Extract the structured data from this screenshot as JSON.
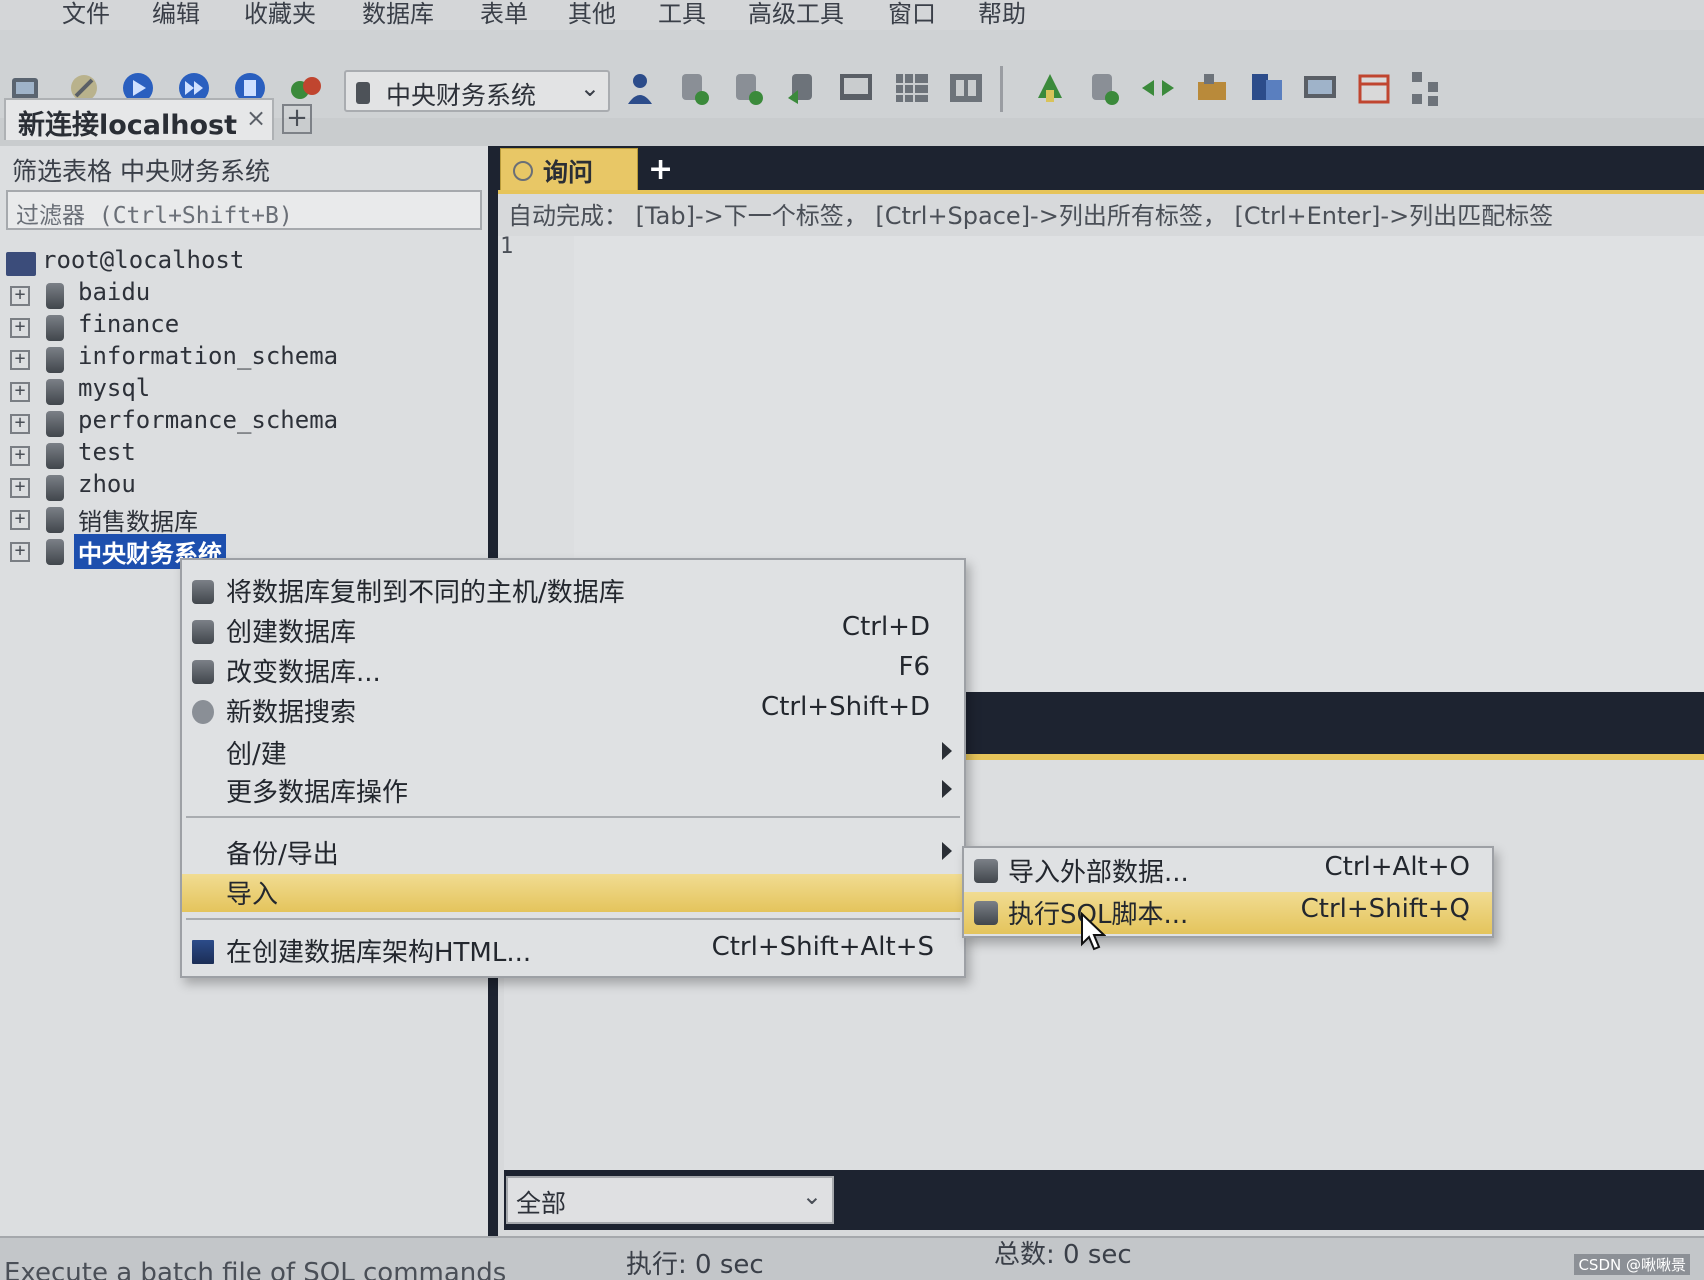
{
  "menubar": {
    "items": [
      "文件",
      "编辑",
      "收藏夹",
      "数据库",
      "表单",
      "其他",
      "工具",
      "高级工具",
      "窗口",
      "帮助"
    ]
  },
  "toolbar": {
    "database_select": "中央财务系统"
  },
  "connection_tab": {
    "label": "新连接localhost",
    "close": "×",
    "add": "+"
  },
  "left_pane": {
    "filter_title": "筛选表格  中央财务系统",
    "filter_placeholder": "过滤器 (Ctrl+Shift+B)",
    "root": "root@localhost",
    "databases": [
      "baidu",
      "finance",
      "information_schema",
      "mysql",
      "performance_schema",
      "test",
      "zhou",
      "销售数据库",
      "中央财务系统"
    ],
    "selected": "中央财务系统"
  },
  "query": {
    "tab_label": "询问",
    "add": "+",
    "hint": "自动完成：  [Tab]->下一个标签，  [Ctrl+Space]->列出所有标签，  [Ctrl+Enter]->列出匹配标签",
    "line_number": "1"
  },
  "result": {
    "filter_value": "全部"
  },
  "context_menu": {
    "items": [
      {
        "label": "将数据库复制到不同的主机/数据库",
        "shortcut": ""
      },
      {
        "label": "创建数据库",
        "shortcut": "Ctrl+D"
      },
      {
        "label": "改变数据库...",
        "shortcut": "F6"
      },
      {
        "label": "新数据搜索",
        "shortcut": "Ctrl+Shift+D"
      },
      {
        "label": "创/建",
        "shortcut": ""
      },
      {
        "label": "更多数据库操作",
        "shortcut": ""
      },
      {
        "label": "备份/导出",
        "shortcut": ""
      },
      {
        "label": "导入",
        "shortcut": ""
      },
      {
        "label": "在创建数据库架构HTML...",
        "shortcut": "Ctrl+Shift+Alt+S"
      }
    ]
  },
  "submenu": {
    "items": [
      {
        "label": "导入外部数据...",
        "shortcut": "Ctrl+Alt+O"
      },
      {
        "label": "执行SQL脚本...",
        "shortcut": "Ctrl+Shift+Q"
      }
    ]
  },
  "statusbar": {
    "message": "Execute a batch file of SQL commands",
    "exec": "执行: 0 sec",
    "total": "总数: 0 sec",
    "watermark": "CSDN @啾啾景"
  },
  "colors": {
    "selection": "#1d4fae",
    "highlight": "#e8c766",
    "dark_band": "#1d2330"
  }
}
